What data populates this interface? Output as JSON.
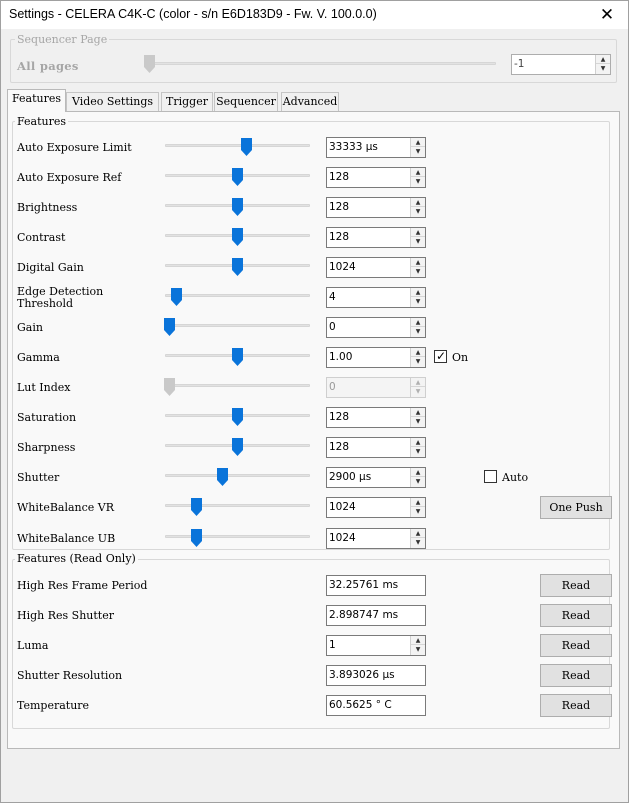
{
  "window": {
    "title": "Settings - CELERA C4K-C (color - s/n E6D183D9 - Fw. V. 100.0.0)",
    "close_glyph": "✕"
  },
  "sequencer": {
    "group_label": "Sequencer Page",
    "all_pages_label": "All pages",
    "page_value": "-1",
    "slider_fraction": 0.0
  },
  "tabs": [
    {
      "label": "Features",
      "active": true
    },
    {
      "label": "Video Settings",
      "active": false
    },
    {
      "label": "Trigger",
      "active": false
    },
    {
      "label": "Sequencer",
      "active": false
    },
    {
      "label": "Advanced",
      "active": false
    }
  ],
  "features": {
    "group_label": "Features",
    "rows": [
      {
        "label": "Auto Exposure Limit",
        "value": "33333 µs",
        "slider_fraction": 0.57,
        "enabled": true
      },
      {
        "label": "Auto Exposure Ref",
        "value": "128",
        "slider_fraction": 0.5,
        "enabled": true
      },
      {
        "label": "Brightness",
        "value": "128",
        "slider_fraction": 0.5,
        "enabled": true
      },
      {
        "label": "Contrast",
        "value": "128",
        "slider_fraction": 0.5,
        "enabled": true
      },
      {
        "label": "Digital Gain",
        "value": "1024",
        "slider_fraction": 0.5,
        "enabled": true
      },
      {
        "label": "Edge Detection\nThreshold",
        "value": "4",
        "slider_fraction": 0.05,
        "enabled": true
      },
      {
        "label": "Gain",
        "value": "0",
        "slider_fraction": 0.0,
        "enabled": true
      },
      {
        "label": "Gamma",
        "value": "1.00",
        "slider_fraction": 0.5,
        "enabled": true
      },
      {
        "label": "Lut Index",
        "value": "0",
        "slider_fraction": 0.0,
        "enabled": false
      },
      {
        "label": "Saturation",
        "value": "128",
        "slider_fraction": 0.5,
        "enabled": true
      },
      {
        "label": "Sharpness",
        "value": "128",
        "slider_fraction": 0.5,
        "enabled": true
      },
      {
        "label": "Shutter",
        "value": "2900 µs",
        "slider_fraction": 0.39,
        "enabled": true
      },
      {
        "label": "WhiteBalance VR",
        "value": "1024",
        "slider_fraction": 0.2,
        "enabled": true
      },
      {
        "label": "WhiteBalance UB",
        "value": "1024",
        "slider_fraction": 0.2,
        "enabled": true
      }
    ],
    "gamma_on_label": "On",
    "gamma_on_checked": true,
    "shutter_auto_label": "Auto",
    "shutter_auto_checked": false,
    "one_push_label": "One Push"
  },
  "read_only": {
    "group_label": "Features (Read Only)",
    "rows": [
      {
        "label": "High Res Frame Period",
        "value": "32.25761 ms",
        "spin": false,
        "button": "Read"
      },
      {
        "label": "High Res Shutter",
        "value": "2.898747 ms",
        "spin": false,
        "button": "Read"
      },
      {
        "label": "Luma",
        "value": "1",
        "spin": true,
        "button": "Read"
      },
      {
        "label": "Shutter Resolution",
        "value": "3.893026 µs",
        "spin": false,
        "button": "Read"
      },
      {
        "label": "Temperature",
        "value": "60.5625 ° C",
        "spin": false,
        "button": "Read"
      }
    ]
  },
  "colors": {
    "slider_thumb": "#0a74da",
    "slider_thumb_disabled": "#c9c9c9"
  }
}
